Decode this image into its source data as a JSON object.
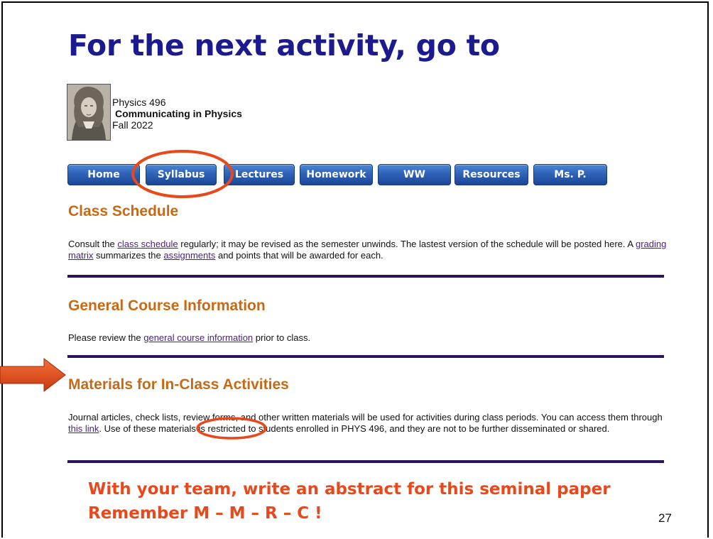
{
  "slide": {
    "title": "For the next activity, go to",
    "page_number": "27"
  },
  "course": {
    "line1": "Physics 496",
    "line2": "Communicating in Physics",
    "line3": "Fall 2022"
  },
  "nav": {
    "items": [
      {
        "label": "Home"
      },
      {
        "label": "Syllabus"
      },
      {
        "label": "Lectures"
      },
      {
        "label": "Homework"
      },
      {
        "label": "WW"
      },
      {
        "label": "Resources"
      },
      {
        "label": "Ms. P."
      }
    ]
  },
  "sections": {
    "schedule": {
      "heading": "Class Schedule",
      "text1": "Consult the ",
      "link1": "class schedule",
      "text2": " regularly; it may be revised as the semester unwinds. The lastest version of the schedule will be posted here. A ",
      "link2": "grading matrix",
      "text3": " summarizes the ",
      "link3": "assignments",
      "text4": " and points that will be awarded for each."
    },
    "general": {
      "heading": "General Course Information",
      "text1": "Please review the ",
      "link1": "general course information",
      "text2": " prior to class."
    },
    "materials": {
      "heading": "Materials for In-Class Activities",
      "text1": "Journal articles, check lists, review forms, and other written materials will be used for activities during class periods. You can access them through ",
      "link1": "this link",
      "text2": ". Use of these materials is restricted to students enrolled in PHYS 496, and they are not to be further disseminated or shared."
    }
  },
  "footer": {
    "line1": "With your team, write an abstract for this seminal paper",
    "line2": "Remember M – M – R – C !"
  },
  "colors": {
    "title": "#1b1b8f",
    "heading": "#c86a14",
    "link": "#4b1d86",
    "rule": "#2c135e",
    "annotation": "#e8481a",
    "nav_button": "#2f63b8"
  }
}
